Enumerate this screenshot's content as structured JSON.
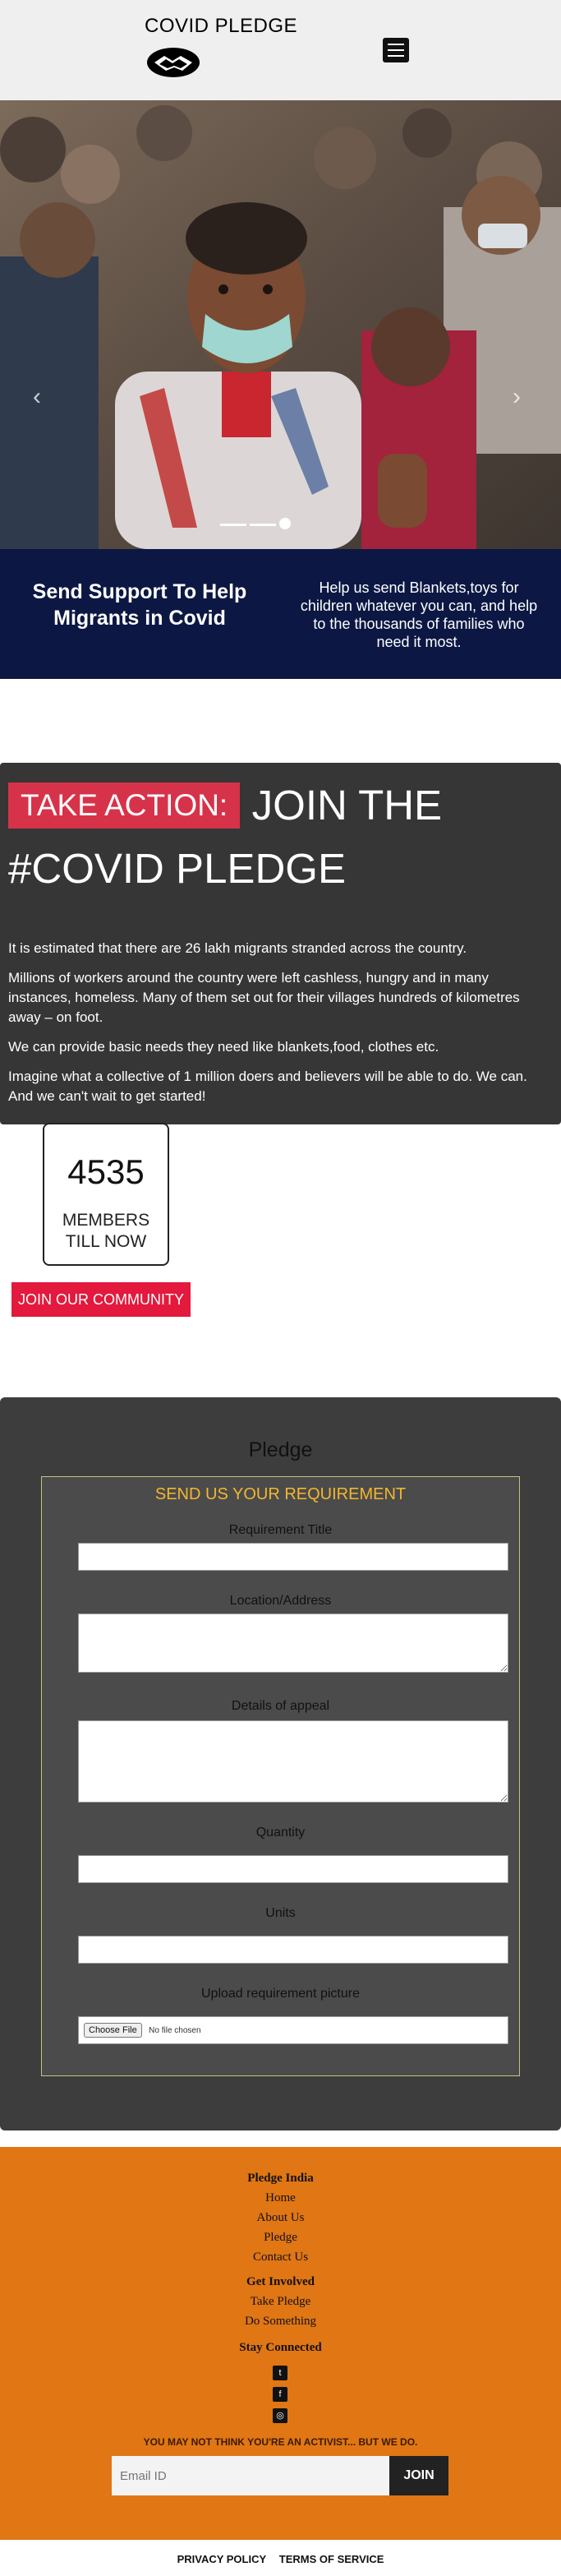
{
  "header": {
    "brand": "COVID PLEDGE",
    "logo_icon": "handshake-icon",
    "menu_icon": "hamburger-menu-icon"
  },
  "hero": {
    "prev_glyph": "‹",
    "next_glyph": "›",
    "slide_count": 3,
    "active_slide": 3
  },
  "banner": {
    "title": "Send Support To Help Migrants in Covid",
    "text": "Help us send Blankets,toys for children whatever you can, and help to the thousands of families who need it most."
  },
  "action": {
    "badge": "TAKE ACTION:",
    "join": "JOIN THE",
    "hashtag": "#COVID PLEDGE",
    "paragraphs": [
      "It is estimated that there are 26 lakh migrants stranded across the country.",
      "Millions of workers around the country were left cashless, hungry and in many instances, homeless. Many of them set out for their villages hundreds of kilometres away – on foot.",
      "We can provide basic needs they need like blankets,food, clothes etc.",
      "Imagine what a collective of 1 million doers and believers will be able to do. We can. And we can't wait to get started!"
    ]
  },
  "members": {
    "count": "4535",
    "label": "MEMBERS TILL NOW",
    "join_button": "JOIN OUR COMMUNITY"
  },
  "pledge": {
    "heading": "Pledge",
    "form_title": "SEND US YOUR REQUIREMENT",
    "labels": {
      "title": "Requirement Title",
      "location": "Location/Address",
      "details": "Details of appeal",
      "quantity": "Quantity",
      "units": "Units",
      "upload": "Upload requirement picture"
    },
    "file_button": "Choose File",
    "file_status": "No file chosen"
  },
  "footer": {
    "group1": {
      "heading": "Pledge India",
      "links": [
        "Home",
        "About Us",
        "Pledge",
        "Contact Us"
      ]
    },
    "group2": {
      "heading": "Get Involved",
      "links": [
        "Take Pledge",
        "Do Something"
      ]
    },
    "group3": {
      "heading": "Stay Connected",
      "icons": [
        "twitter-icon",
        "facebook-icon",
        "instagram-icon"
      ]
    },
    "tagline": "YOU MAY NOT THINK YOU'RE AN ACTIVIST... BUT WE DO.",
    "email_placeholder": "Email ID",
    "join_button": "JOIN"
  },
  "bottom": {
    "privacy": "PRIVACY POLICY",
    "terms": "TERMS OF SERVICE"
  }
}
